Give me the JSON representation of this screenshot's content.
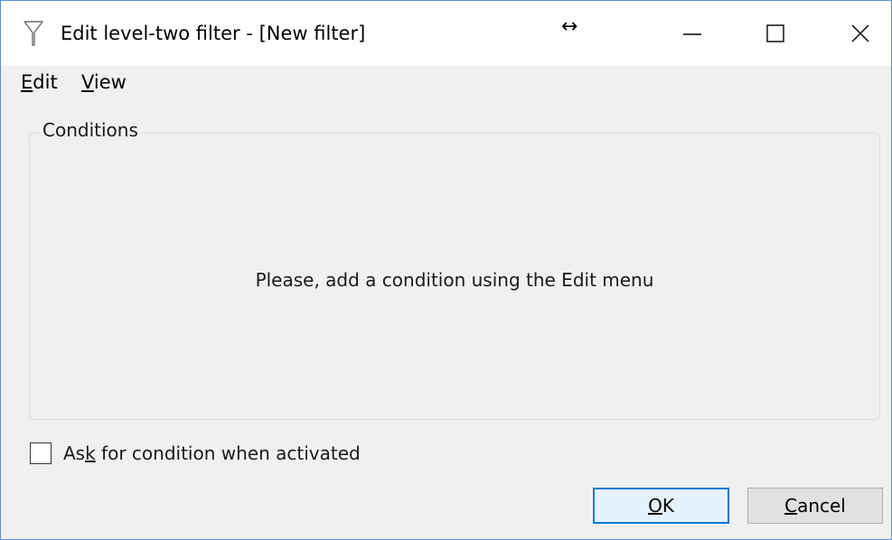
{
  "window": {
    "title": "Edit level-two filter - [New filter]",
    "title_icon": "filter-funnel-icon",
    "resize_cursor": "↔"
  },
  "menubar": {
    "edit": {
      "prefix": "",
      "accel": "E",
      "rest": "dit"
    },
    "view": {
      "prefix": "",
      "accel": "V",
      "rest": "iew"
    }
  },
  "conditions": {
    "label": "Conditions",
    "empty_message": "Please, add a condition using the Edit menu"
  },
  "ask_checkbox": {
    "label_before": "As",
    "label_accel": "k",
    "label_after": " for condition when activated",
    "checked": false
  },
  "buttons": {
    "ok": {
      "prefix": "",
      "accel": "O",
      "rest": "K"
    },
    "cancel": {
      "prefix": "",
      "accel": "C",
      "rest": "ancel"
    }
  }
}
